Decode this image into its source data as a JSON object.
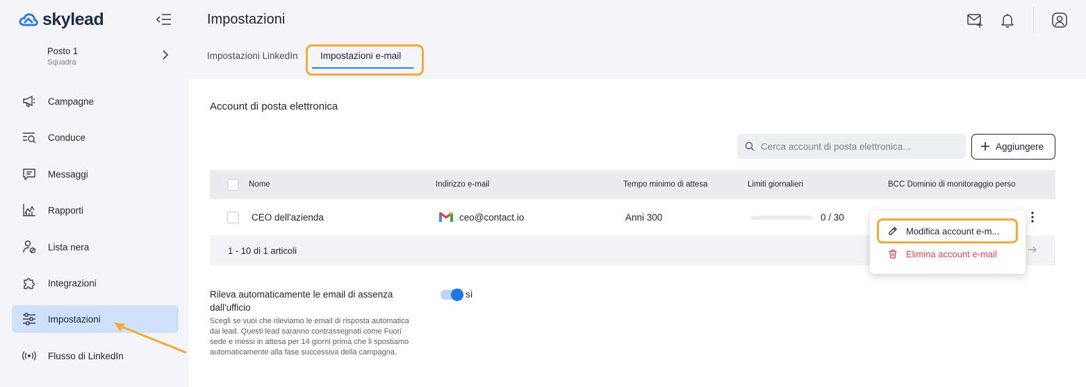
{
  "brand": {
    "name": "skylead"
  },
  "sidebar": {
    "team": {
      "name": "Posto 1",
      "subtitle": "Squadra"
    },
    "items": [
      {
        "label": "Campagne",
        "icon": "megaphone-icon"
      },
      {
        "label": "Conduce",
        "icon": "leads-search-icon"
      },
      {
        "label": "Messaggi",
        "icon": "message-icon"
      },
      {
        "label": "Rapporti",
        "icon": "chart-icon"
      },
      {
        "label": "Lista nera",
        "icon": "user-block-icon"
      },
      {
        "label": "Integrazioni",
        "icon": "puzzle-icon"
      },
      {
        "label": "Impostazioni",
        "icon": "sliders-icon",
        "active": true
      },
      {
        "label": "Flusso di LinkedIn",
        "icon": "broadcast-icon"
      }
    ]
  },
  "header": {
    "title": "Impostazioni",
    "tabs": [
      {
        "label": "Impostazioni LinkedIn",
        "active": false
      },
      {
        "label": "Impostazioni e-mail",
        "active": true
      }
    ]
  },
  "main": {
    "section_title": "Account di posta elettronica",
    "search": {
      "placeholder": "Cerca account di posta elettronica..."
    },
    "add_button": "Aggiungere",
    "table": {
      "columns": [
        "Nome",
        "Indirizzo e-mail",
        "Tempo minimo di attesa",
        "Limiti giornalieri",
        "BCC Dominio di monitoraggio perso"
      ],
      "rows": [
        {
          "name": "CEO dell'azienda",
          "email": "ceo@contact.io",
          "wait": "Anni 300",
          "limit": "0 / 30",
          "limit_fraction": 0
        }
      ],
      "pagination": "1 - 10 di 1 articoli"
    },
    "out_of_office": {
      "title": "Rileva automaticamente le email di assenza dall'ufficio",
      "description": "Scegli se vuoi che rileviamo le email di risposta automatica dai lead. Questi lead saranno contrassegnati come Fuori sede e messi in attesa per 14 giorni prima che li spostiamo automaticamente alla fase successiva della campagna.",
      "toggle_label": "sì",
      "enabled": true
    }
  },
  "context_menu": {
    "items": [
      {
        "label": "Modifica account e-m...",
        "icon": "edit-icon"
      },
      {
        "label": "Elimina account e-mail",
        "icon": "trash-icon"
      }
    ]
  },
  "colors": {
    "accent": "#2d7be5",
    "highlight": "#f2a93b",
    "danger": "#d64550",
    "active_nav": "#cfe2f9"
  }
}
